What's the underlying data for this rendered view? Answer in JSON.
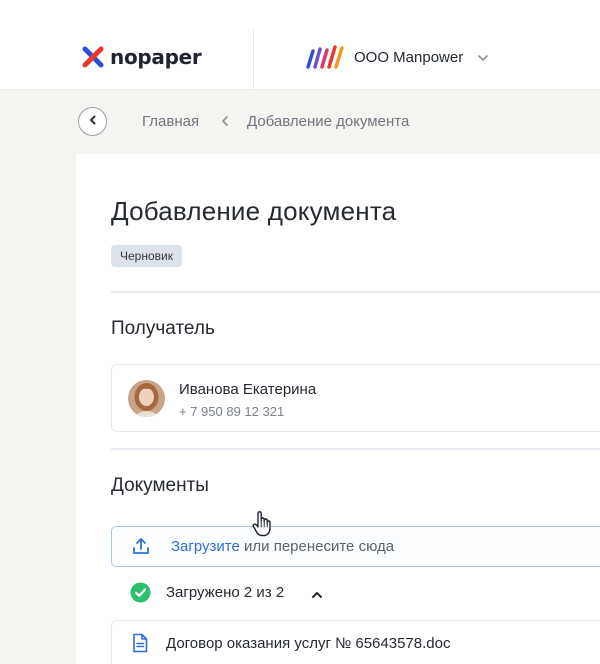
{
  "header": {
    "logo_text": "nopaper",
    "company_name": "ООО Manpower",
    "colors": {
      "logo_red": "#e8382f",
      "logo_blue": "#2e4fd8"
    }
  },
  "breadcrumbs": {
    "items": [
      "Главная",
      "Добавление документа"
    ]
  },
  "page": {
    "title": "Добавление документа",
    "status_badge": "Черновик"
  },
  "recipient": {
    "section_title": "Получатель",
    "name": "Иванова Екатерина",
    "phone": "+ 7 950 89 12 321"
  },
  "documents": {
    "section_title": "Документы",
    "upload_link": "Загрузите",
    "upload_rest": " или перенесите сюда",
    "uploaded_status": "Загружено 2 из 2",
    "files": [
      {
        "name": "Договор оказания услуг № 65643578.doc"
      }
    ]
  },
  "icons": {
    "back": "chevron-left-icon",
    "company_menu": "chevron-down-icon",
    "upload": "upload-icon",
    "status": "check-circle-icon",
    "collapse": "chevron-up-icon",
    "file": "document-icon",
    "cursor": "hand-pointer-icon"
  },
  "colors": {
    "accent": "#2f6fd8",
    "success": "#2dbf6c",
    "badge_bg": "#dde2ea"
  }
}
